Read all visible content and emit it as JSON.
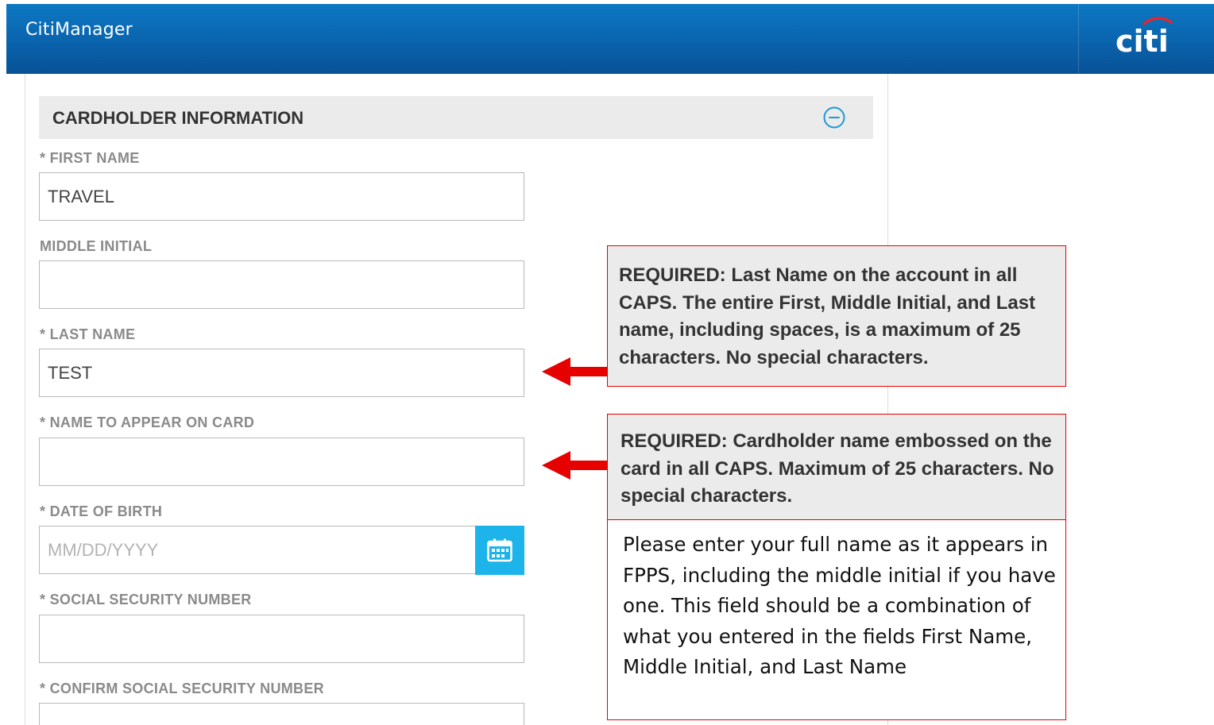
{
  "header": {
    "app_title": "CitiManager",
    "logo_text": "citi"
  },
  "section": {
    "title": "CARDHOLDER INFORMATION",
    "collapse_icon": "minus-circle-icon"
  },
  "fields": {
    "first_name": {
      "label": "* FIRST NAME",
      "value": "TRAVEL"
    },
    "middle_initial": {
      "label": "MIDDLE INITIAL",
      "value": ""
    },
    "last_name": {
      "label": "* LAST NAME",
      "value": "TEST"
    },
    "name_on_card": {
      "label": "* NAME TO APPEAR ON CARD",
      "value": ""
    },
    "date_of_birth": {
      "label": "* DATE OF BIRTH",
      "value": "",
      "placeholder": "MM/DD/YYYY",
      "icon": "calendar-icon"
    },
    "ssn": {
      "label": "* SOCIAL SECURITY NUMBER",
      "value": ""
    },
    "confirm_ssn": {
      "label": "* CONFIRM SOCIAL SECURITY NUMBER",
      "value": ""
    }
  },
  "annotations": {
    "last_name_note": "REQUIRED: Last Name on the account in all CAPS. The entire First, Middle Initial, and Last name, including spaces, is a maximum of 25 characters. No special characters.",
    "name_on_card_note": "REQUIRED: Cardholder name embossed on the card in all CAPS. Maximum of 25 characters. No special characters.",
    "full_name_note": "Please enter your full name as it appears in FPPS, including the middle initial if you have one. This field should be a combination of what you entered in the fields First Name, Middle Initial, and Last Name"
  },
  "colors": {
    "header_blue": "#0a63ad",
    "calendar_button": "#1cb4ea",
    "annotation_border": "#e60000",
    "arrow": "#e60000",
    "logo_arc": "#e3262d"
  }
}
